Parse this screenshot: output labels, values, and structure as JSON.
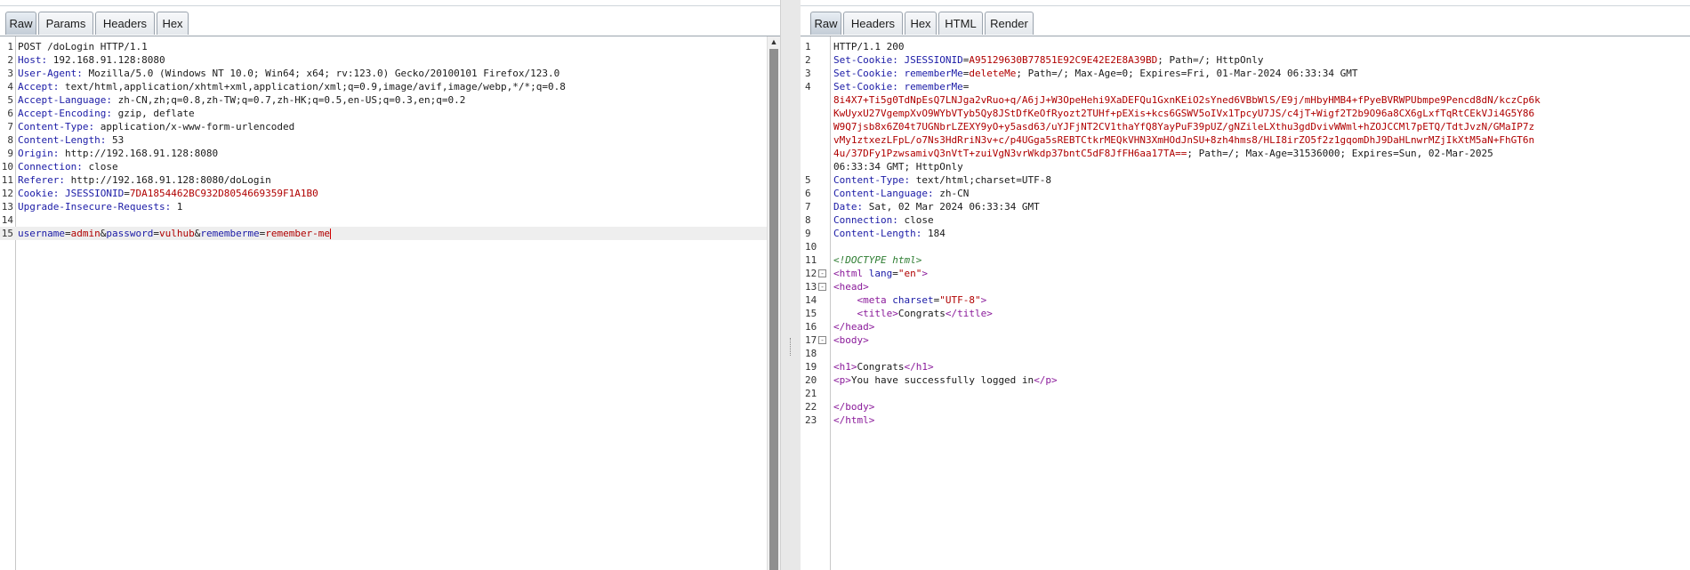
{
  "request": {
    "tabs": [
      {
        "label": "Raw"
      },
      {
        "label": "Params"
      },
      {
        "label": "Headers"
      },
      {
        "label": "Hex"
      }
    ],
    "lines": [
      {
        "n": "1",
        "segs": [
          {
            "c": "hv",
            "t": "POST /doLogin HTTP/1.1"
          }
        ]
      },
      {
        "n": "2",
        "segs": [
          {
            "c": "hk",
            "t": "Host:"
          },
          {
            "c": "hv",
            "t": " 192.168.91.128:8080"
          }
        ]
      },
      {
        "n": "3",
        "segs": [
          {
            "c": "hk",
            "t": "User-Agent:"
          },
          {
            "c": "hv",
            "t": " Mozilla/5.0 (Windows NT 10.0; Win64; x64; rv:123.0) Gecko/20100101 Firefox/123.0"
          }
        ]
      },
      {
        "n": "4",
        "segs": [
          {
            "c": "hk",
            "t": "Accept:"
          },
          {
            "c": "hv",
            "t": " text/html,application/xhtml+xml,application/xml;q=0.9,image/avif,image/webp,*/*;q=0.8"
          }
        ]
      },
      {
        "n": "5",
        "segs": [
          {
            "c": "hk",
            "t": "Accept-Language:"
          },
          {
            "c": "hv",
            "t": " zh-CN,zh;q=0.8,zh-TW;q=0.7,zh-HK;q=0.5,en-US;q=0.3,en;q=0.2"
          }
        ]
      },
      {
        "n": "6",
        "segs": [
          {
            "c": "hk",
            "t": "Accept-Encoding:"
          },
          {
            "c": "hv",
            "t": " gzip, deflate"
          }
        ]
      },
      {
        "n": "7",
        "segs": [
          {
            "c": "hk",
            "t": "Content-Type:"
          },
          {
            "c": "hv",
            "t": " application/x-www-form-urlencoded"
          }
        ]
      },
      {
        "n": "8",
        "segs": [
          {
            "c": "hk",
            "t": "Content-Length:"
          },
          {
            "c": "hv",
            "t": " 53"
          }
        ]
      },
      {
        "n": "9",
        "segs": [
          {
            "c": "hk",
            "t": "Origin:"
          },
          {
            "c": "hv",
            "t": " http://192.168.91.128:8080"
          }
        ]
      },
      {
        "n": "10",
        "segs": [
          {
            "c": "hk",
            "t": "Connection:"
          },
          {
            "c": "hv",
            "t": " close"
          }
        ]
      },
      {
        "n": "11",
        "segs": [
          {
            "c": "hk",
            "t": "Referer:"
          },
          {
            "c": "hv",
            "t": " http://192.168.91.128:8080/doLogin"
          }
        ]
      },
      {
        "n": "12",
        "segs": [
          {
            "c": "hk",
            "t": "Cookie:"
          },
          {
            "c": "hv",
            "t": " "
          },
          {
            "c": "ck",
            "t": "JSESSIONID"
          },
          {
            "c": "hv",
            "t": "="
          },
          {
            "c": "cv",
            "t": "7DA1854462BC932D8054669359F1A1B0"
          }
        ]
      },
      {
        "n": "13",
        "segs": [
          {
            "c": "hk",
            "t": "Upgrade-Insecure-Requests:"
          },
          {
            "c": "hv",
            "t": " 1"
          }
        ]
      },
      {
        "n": "14",
        "segs": []
      },
      {
        "n": "15",
        "hl": true,
        "caret": true,
        "segs": [
          {
            "c": "pk",
            "t": "username"
          },
          {
            "c": "hv",
            "t": "="
          },
          {
            "c": "pv",
            "t": "admin"
          },
          {
            "c": "hv",
            "t": "&"
          },
          {
            "c": "pk",
            "t": "password"
          },
          {
            "c": "hv",
            "t": "="
          },
          {
            "c": "pv",
            "t": "vulhub"
          },
          {
            "c": "hv",
            "t": "&"
          },
          {
            "c": "pk",
            "t": "rememberme"
          },
          {
            "c": "hv",
            "t": "="
          },
          {
            "c": "pv",
            "t": "remember-me"
          }
        ]
      }
    ]
  },
  "response": {
    "tabs": [
      {
        "label": "Raw"
      },
      {
        "label": "Headers"
      },
      {
        "label": "Hex"
      },
      {
        "label": "HTML"
      },
      {
        "label": "Render"
      }
    ],
    "lines": [
      {
        "n": "1",
        "segs": [
          {
            "c": "hv",
            "t": "HTTP/1.1 200"
          }
        ]
      },
      {
        "n": "2",
        "segs": [
          {
            "c": "hk",
            "t": "Set-Cookie:"
          },
          {
            "c": "hv",
            "t": " "
          },
          {
            "c": "ck",
            "t": "JSESSIONID"
          },
          {
            "c": "hv",
            "t": "="
          },
          {
            "c": "cv",
            "t": "A95129630B77851E92C9E42E2E8A39BD"
          },
          {
            "c": "hv",
            "t": "; Path=/; HttpOnly"
          }
        ]
      },
      {
        "n": "3",
        "segs": [
          {
            "c": "hk",
            "t": "Set-Cookie:"
          },
          {
            "c": "hv",
            "t": " "
          },
          {
            "c": "ck",
            "t": "rememberMe"
          },
          {
            "c": "hv",
            "t": "="
          },
          {
            "c": "cv",
            "t": "deleteMe"
          },
          {
            "c": "hv",
            "t": "; Path=/; Max-Age=0; Expires=Fri, 01-Mar-2024 06:33:34 GMT"
          }
        ]
      },
      {
        "n": "4",
        "segs": [
          {
            "c": "hk",
            "t": "Set-Cookie:"
          },
          {
            "c": "hv",
            "t": " "
          },
          {
            "c": "ck",
            "t": "rememberMe"
          },
          {
            "c": "hv",
            "t": "="
          }
        ]
      },
      {
        "n": "",
        "segs": [
          {
            "c": "cv",
            "t": "8i4X7+Ti5g0TdNpEsQ7LNJga2vRuo+q/A6jJ+W3OpeHehi9XaDEFQu1GxnKEiO2sYned6VBbWlS/E9j/mHbyHMB4+fPyeBVRWPUbmpe9Pencd8dN/kczCp6k"
          }
        ]
      },
      {
        "n": "",
        "segs": [
          {
            "c": "cv",
            "t": "KwUyxU27VgempXvO9WYbVTyb5Qy8JStDfKeOfRyozt2TUHf+pEXis+kcs6GSWV5oIVx1TpcyU7JS/c4jT+Wigf2T2b9O96a8CX6gLxfTqRtCEkVJi4G5Y86"
          }
        ]
      },
      {
        "n": "",
        "segs": [
          {
            "c": "cv",
            "t": "W9Q7jsb8x6Z04t7UGNbrLZEXY9yO+y5asd63/uYJFjNT2CV1thaYfQ8YayPuF39pUZ/gNZileLXthu3gdDvivWWml+hZOJCCMl7pETQ/TdtJvzN/GMaIP7z"
          }
        ]
      },
      {
        "n": "",
        "segs": [
          {
            "c": "cv",
            "t": "vMy1ztxezLFpL/o7Ns3HdRriN3v+c/p4UGga5sREBTCtkrMEQkVHN3XmHOdJnSU+8zh4hms8/HLI8irZO5f2z1gqomDhJ9DaHLnwrMZjIkXtM5aN+FhGT6n"
          }
        ]
      },
      {
        "n": "",
        "segs": [
          {
            "c": "cv",
            "t": "4u/37DFy1PzwsamivQ3nVtT+zuiVgN3vrWkdp37bntC5dF8JfFH6aa17TA=="
          },
          {
            "c": "hv",
            "t": "; Path=/; Max-Age=31536000; Expires=Sun, 02-Mar-2025"
          }
        ]
      },
      {
        "n": "",
        "segs": [
          {
            "c": "hv",
            "t": "06:33:34 GMT; HttpOnly"
          }
        ]
      },
      {
        "n": "5",
        "segs": [
          {
            "c": "hk",
            "t": "Content-Type:"
          },
          {
            "c": "hv",
            "t": " text/html;charset=UTF-8"
          }
        ]
      },
      {
        "n": "6",
        "segs": [
          {
            "c": "hk",
            "t": "Content-Language:"
          },
          {
            "c": "hv",
            "t": " zh-CN"
          }
        ]
      },
      {
        "n": "7",
        "segs": [
          {
            "c": "hk",
            "t": "Date:"
          },
          {
            "c": "hv",
            "t": " Sat, 02 Mar 2024 06:33:34 GMT"
          }
        ]
      },
      {
        "n": "8",
        "segs": [
          {
            "c": "hk",
            "t": "Connection:"
          },
          {
            "c": "hv",
            "t": " close"
          }
        ]
      },
      {
        "n": "9",
        "segs": [
          {
            "c": "hk",
            "t": "Content-Length:"
          },
          {
            "c": "hv",
            "t": " 184"
          }
        ]
      },
      {
        "n": "10",
        "segs": []
      },
      {
        "n": "11",
        "segs": [
          {
            "c": "cm",
            "t": "<!DOCTYPE html>"
          }
        ]
      },
      {
        "n": "12",
        "fold": "-",
        "segs": [
          {
            "c": "tg",
            "t": "<html"
          },
          {
            "c": "at",
            "t": " lang"
          },
          {
            "c": "hv",
            "t": "="
          },
          {
            "c": "av",
            "t": "\"en\""
          },
          {
            "c": "tg",
            "t": ">"
          }
        ]
      },
      {
        "n": "13",
        "fold": "-",
        "segs": [
          {
            "c": "tg",
            "t": "<head>"
          }
        ]
      },
      {
        "n": "14",
        "segs": [
          {
            "c": "hv",
            "t": "    "
          },
          {
            "c": "tg",
            "t": "<meta"
          },
          {
            "c": "at",
            "t": " charset"
          },
          {
            "c": "hv",
            "t": "="
          },
          {
            "c": "av",
            "t": "\"UTF-8\""
          },
          {
            "c": "tg",
            "t": ">"
          }
        ]
      },
      {
        "n": "15",
        "segs": [
          {
            "c": "hv",
            "t": "    "
          },
          {
            "c": "tg",
            "t": "<title>"
          },
          {
            "c": "hv",
            "t": "Congrats"
          },
          {
            "c": "tg",
            "t": "</title>"
          }
        ]
      },
      {
        "n": "16",
        "segs": [
          {
            "c": "tg",
            "t": "</head>"
          }
        ]
      },
      {
        "n": "17",
        "fold": "-",
        "segs": [
          {
            "c": "tg",
            "t": "<body>"
          }
        ]
      },
      {
        "n": "18",
        "segs": []
      },
      {
        "n": "19",
        "segs": [
          {
            "c": "tg",
            "t": "<h1>"
          },
          {
            "c": "hv",
            "t": "Congrats"
          },
          {
            "c": "tg",
            "t": "</h1>"
          }
        ]
      },
      {
        "n": "20",
        "segs": [
          {
            "c": "tg",
            "t": "<p>"
          },
          {
            "c": "hv",
            "t": "You have successfully logged in"
          },
          {
            "c": "tg",
            "t": "</p>"
          }
        ]
      },
      {
        "n": "21",
        "segs": []
      },
      {
        "n": "22",
        "segs": [
          {
            "c": "tg",
            "t": "</body>"
          }
        ]
      },
      {
        "n": "23",
        "segs": [
          {
            "c": "tg",
            "t": "</html>"
          }
        ]
      }
    ]
  }
}
